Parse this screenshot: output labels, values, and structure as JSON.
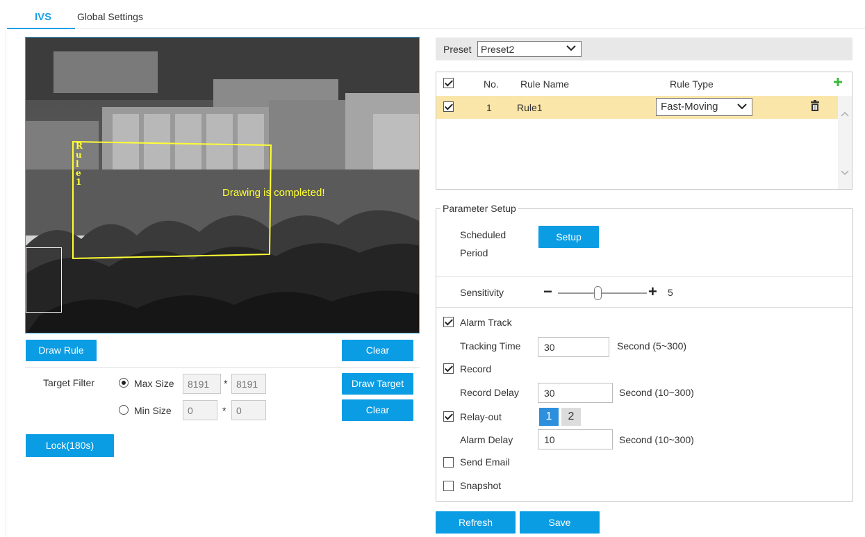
{
  "tabs": [
    {
      "label": "IVS"
    },
    {
      "label": "Global Settings"
    }
  ],
  "video": {
    "rule_label_chars": [
      "R",
      "u",
      "l",
      "e",
      "1"
    ],
    "overlay_text": "Drawing is completed!"
  },
  "left": {
    "draw_rule": "Draw Rule",
    "clear1": "Clear",
    "target_filter": "Target Filter",
    "max_size": "Max Size",
    "max_w": "8191",
    "max_h": "8191",
    "min_size": "Min Size",
    "min_w": "0",
    "min_h": "0",
    "times": "*",
    "draw_target": "Draw Target",
    "clear2": "Clear",
    "lock": "Lock(180s)"
  },
  "preset": {
    "label": "Preset",
    "value": "Preset2"
  },
  "rules": {
    "headers": {
      "no": "No.",
      "name": "Rule Name",
      "type": "Rule Type"
    },
    "rows": [
      {
        "no": "1",
        "name": "Rule1",
        "type": "Fast-Moving",
        "checked": true
      }
    ]
  },
  "params": {
    "legend": "Parameter Setup",
    "scheduled_line1": "Scheduled",
    "scheduled_line2": "Period",
    "setup": "Setup",
    "sensitivity": "Sensitivity",
    "sensitivity_value": "5",
    "sensitivity_level": 0.5,
    "minus": "−",
    "plus": "+",
    "alarm_track": "Alarm Track",
    "tracking_time": "Tracking Time",
    "tracking_value": "30",
    "tracking_unit": "Second (5~300)",
    "record": "Record",
    "record_delay": "Record Delay",
    "record_value": "30",
    "record_unit": "Second (10~300)",
    "relay_out": "Relay-out",
    "relay_1": "1",
    "relay_2": "2",
    "alarm_delay": "Alarm Delay",
    "alarm_value": "10",
    "alarm_unit": "Second (10~300)",
    "send_email": "Send Email",
    "snapshot": "Snapshot"
  },
  "footer": {
    "refresh": "Refresh",
    "save": "Save"
  },
  "colors": {
    "accent": "#0a9de4",
    "rule_yellow": "#ffff33",
    "row_highlight": "#fbe6a9",
    "header_gray": "#e8e8e8"
  }
}
